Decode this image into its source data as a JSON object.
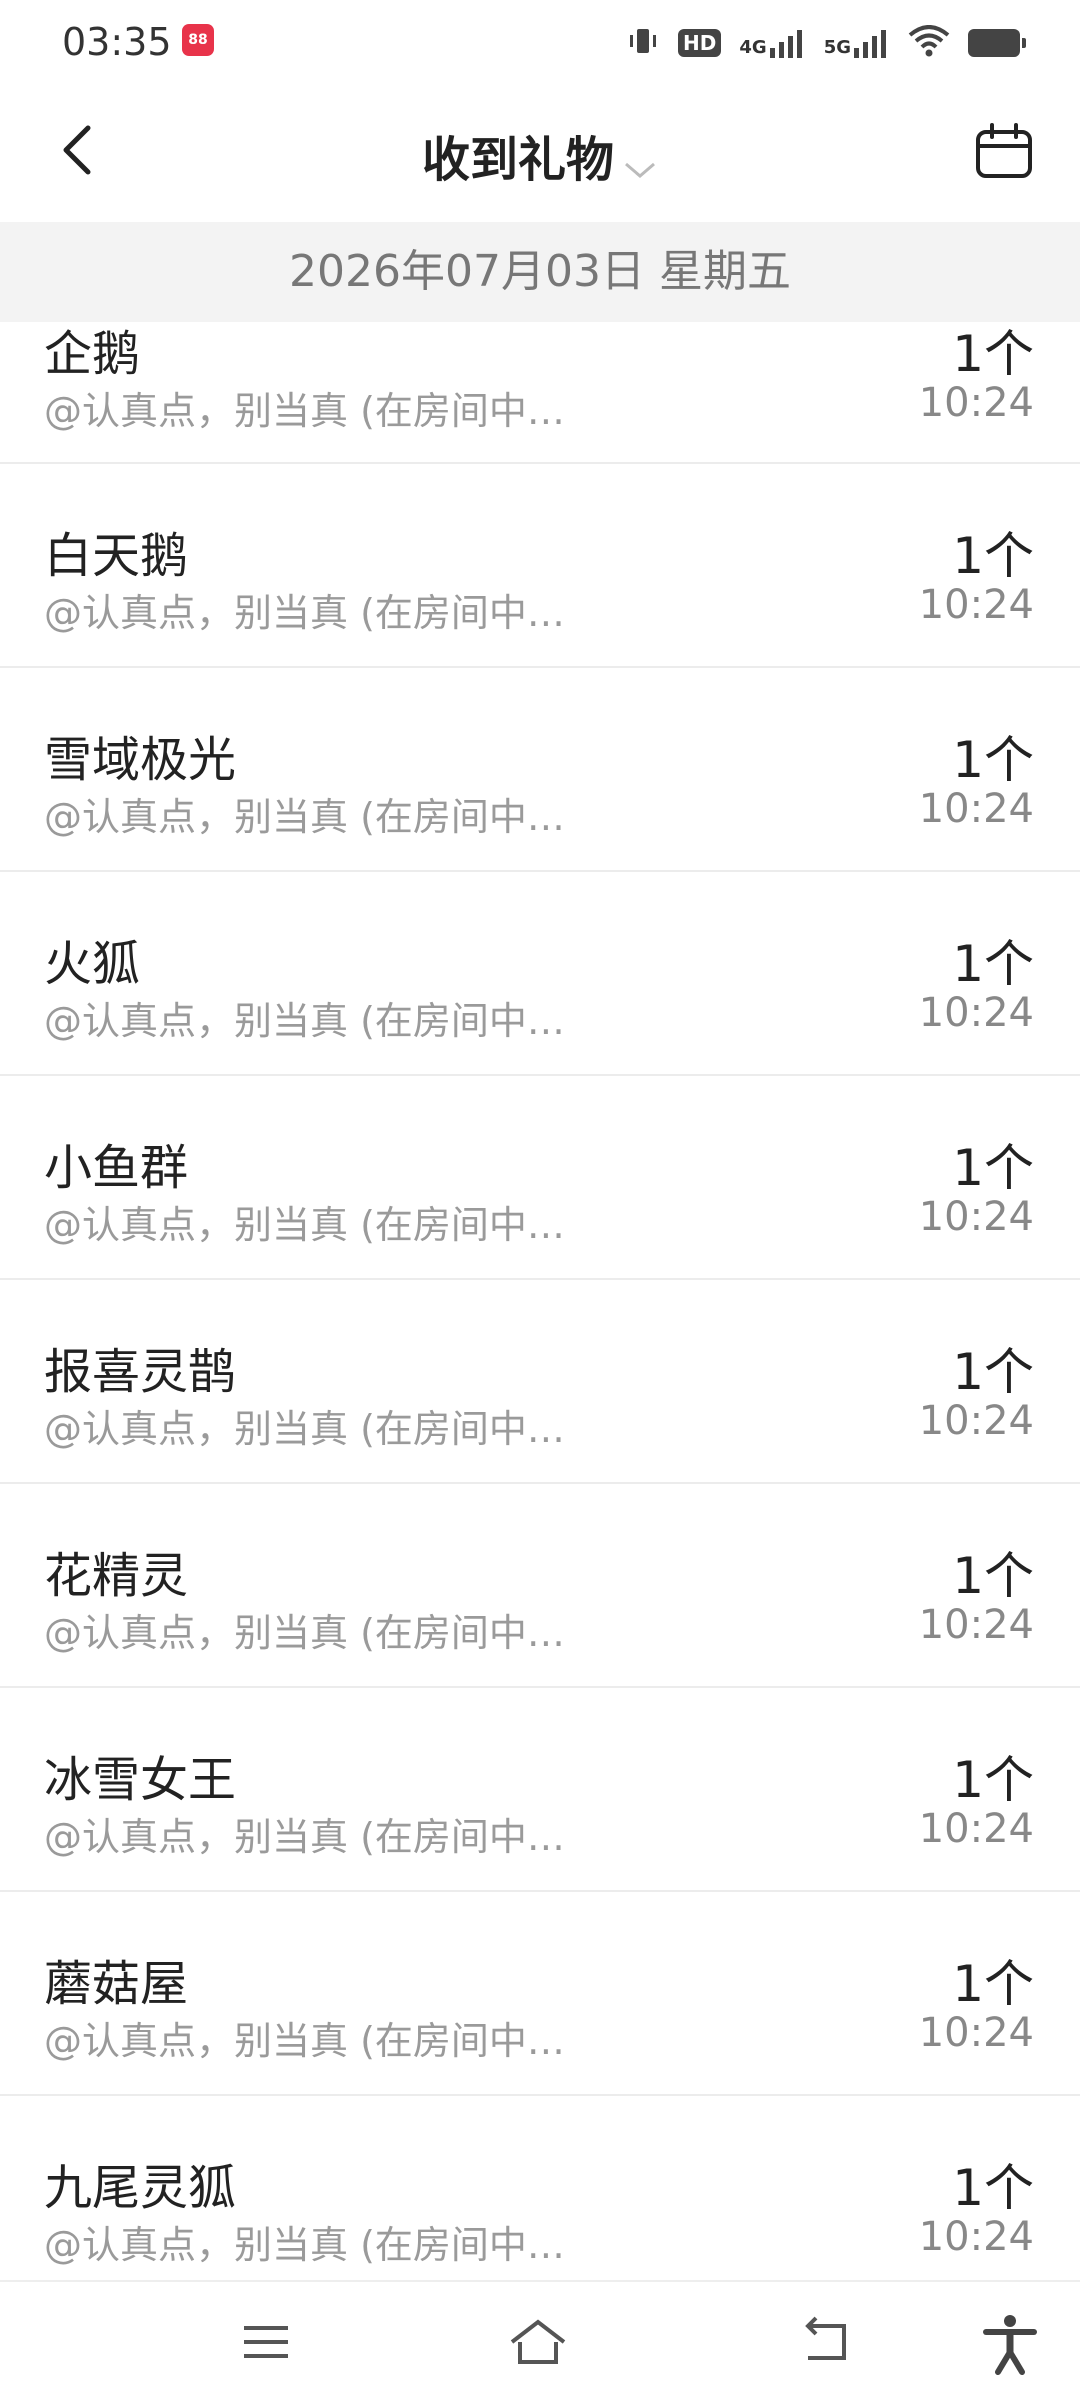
{
  "status_bar": {
    "time": "03:35",
    "app_badge": "88",
    "icons": [
      "vibrate-icon",
      "hd-icon",
      "signal-4g-icon",
      "signal-5g-icon",
      "wifi-icon",
      "battery-icon"
    ],
    "hd_label": "HD",
    "net1_label": "4G",
    "net2_label": "5G"
  },
  "header": {
    "title": "收到礼物"
  },
  "date_bar": "2026年07月03日 星期五",
  "items": [
    {
      "name": "企鹅",
      "sender": "@认真点，别当真 (在房间中…",
      "qty": "1个",
      "time": "10:24"
    },
    {
      "name": "白天鹅",
      "sender": "@认真点，别当真 (在房间中…",
      "qty": "1个",
      "time": "10:24"
    },
    {
      "name": "雪域极光",
      "sender": "@认真点，别当真 (在房间中…",
      "qty": "1个",
      "time": "10:24"
    },
    {
      "name": "火狐",
      "sender": "@认真点，别当真 (在房间中…",
      "qty": "1个",
      "time": "10:24"
    },
    {
      "name": "小鱼群",
      "sender": "@认真点，别当真 (在房间中…",
      "qty": "1个",
      "time": "10:24"
    },
    {
      "name": "报喜灵鹊",
      "sender": "@认真点，别当真 (在房间中…",
      "qty": "1个",
      "time": "10:24"
    },
    {
      "name": "花精灵",
      "sender": "@认真点，别当真 (在房间中…",
      "qty": "1个",
      "time": "10:24"
    },
    {
      "name": "冰雪女王",
      "sender": "@认真点，别当真 (在房间中…",
      "qty": "1个",
      "time": "10:24"
    },
    {
      "name": "蘑菇屋",
      "sender": "@认真点，别当真 (在房间中…",
      "qty": "1个",
      "time": "10:24"
    },
    {
      "name": "九尾灵狐",
      "sender": "@认真点，别当真 (在房间中…",
      "qty": "1个",
      "time": "10:24"
    }
  ],
  "nav": {
    "icons": [
      "menu-icon",
      "home-icon",
      "back-icon",
      "accessibility-icon"
    ]
  }
}
